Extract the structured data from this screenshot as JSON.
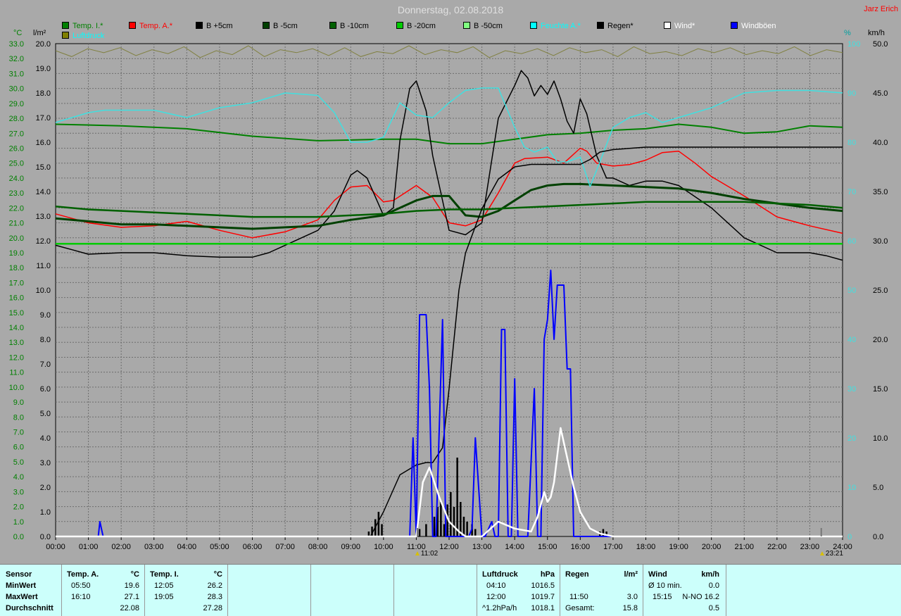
{
  "header": {
    "title": "Donnerstag, 02.08.2018",
    "author": "Jarz Erich"
  },
  "axis_units": {
    "temp": "°C",
    "rain": "l/m²",
    "right1": "%",
    "right2": "km/h"
  },
  "legend": [
    {
      "label": "Temp. I.*",
      "color": "#008000"
    },
    {
      "label": "Temp. A.*",
      "color": "#ff0000"
    },
    {
      "label": "B +5cm",
      "color": "#000000"
    },
    {
      "label": "B -5cm",
      "color": "#004000"
    },
    {
      "label": "B -10cm",
      "color": "#006000"
    },
    {
      "label": "B -20cm",
      "color": "#00cc00"
    },
    {
      "label": "B -50cm",
      "color": "#80ff80"
    },
    {
      "label": "Feuchte A.*",
      "color": "#00ffff"
    },
    {
      "label": "Regen*",
      "color": "#000000"
    },
    {
      "label": "Wind*",
      "color": "#ffffff"
    },
    {
      "label": "Windböen",
      "color": "#0000ff"
    },
    {
      "label": "Luftdruck",
      "color": "#808000"
    }
  ],
  "chart_data": {
    "type": "line",
    "title": "Donnerstag, 02.08.2018",
    "x_ticks": [
      "00:00",
      "01:00",
      "02:00",
      "03:00",
      "04:00",
      "05:00",
      "06:00",
      "07:00",
      "08:00",
      "09:00",
      "10:00",
      "11:00",
      "12:00",
      "13:00",
      "14:00",
      "15:00",
      "16:00",
      "17:00",
      "18:00",
      "19:00",
      "20:00",
      "21:00",
      "22:00",
      "23:00",
      "24:00"
    ],
    "temp_ticks": [
      "0.0",
      "1.0",
      "2.0",
      "3.0",
      "4.0",
      "5.0",
      "6.0",
      "7.0",
      "8.0",
      "9.0",
      "10.0",
      "11.0",
      "12.0",
      "13.0",
      "14.0",
      "15.0",
      "16.0",
      "17.0",
      "18.0",
      "19.0",
      "20.0",
      "21.0",
      "22.0",
      "23.0",
      "24.0",
      "25.0",
      "26.0",
      "27.0",
      "28.0",
      "29.0",
      "30.0",
      "31.0",
      "32.0",
      "33.0"
    ],
    "rain_ticks": [
      "0.0",
      "1.0",
      "2.0",
      "3.0",
      "4.0",
      "5.0",
      "6.0",
      "7.0",
      "8.0",
      "9.0",
      "10.0",
      "11.0",
      "12.0",
      "13.0",
      "14.0",
      "15.0",
      "16.0",
      "17.0",
      "18.0",
      "19.0",
      "20.0"
    ],
    "hum_ticks": [
      "0",
      "10",
      "20",
      "30",
      "40",
      "50",
      "60",
      "70",
      "80",
      "90",
      "100"
    ],
    "wind_ticks": [
      "0.0",
      "5.0",
      "10.0",
      "15.0",
      "20.0",
      "25.0",
      "30.0",
      "35.0",
      "40.0",
      "45.0",
      "50.0"
    ],
    "temp_range": [
      0,
      33
    ],
    "hum_range": [
      0,
      100
    ],
    "wind_range": [
      0,
      50
    ],
    "grid": true,
    "series": [
      {
        "name": "Temp. A.*",
        "color": "#ff0000",
        "width": 1.5,
        "axis": "temp",
        "x": [
          0,
          0.5,
          1,
          2,
          3,
          4,
          5,
          6,
          7,
          8,
          8.5,
          9,
          9.5,
          10,
          10.3,
          11,
          11.5,
          12,
          12.5,
          13,
          13.5,
          14,
          14.3,
          15,
          15.5,
          16,
          16.2,
          16.5,
          17,
          17.5,
          18,
          18.5,
          19,
          19.5,
          20,
          21,
          22,
          23,
          24
        ],
        "y": [
          21.6,
          21.3,
          21.0,
          20.7,
          20.8,
          21.1,
          20.5,
          20.0,
          20.4,
          21.2,
          22.5,
          23.4,
          23.5,
          22.4,
          22.5,
          23.5,
          22.7,
          21.0,
          20.8,
          21.2,
          23.0,
          25.0,
          25.3,
          25.4,
          25.0,
          26.0,
          25.8,
          25.0,
          24.8,
          24.9,
          25.2,
          25.7,
          25.8,
          25.0,
          24.1,
          22.8,
          21.4,
          20.8,
          20.3
        ]
      },
      {
        "name": "Temp. I.*",
        "color": "#008000",
        "width": 2,
        "axis": "temp",
        "x": [
          0,
          2,
          4,
          6,
          8,
          10,
          11,
          12,
          13,
          14,
          15,
          16,
          17,
          18,
          19,
          20,
          21,
          22,
          23,
          24
        ],
        "y": [
          27.6,
          27.5,
          27.3,
          26.8,
          26.5,
          26.6,
          26.6,
          26.3,
          26.3,
          26.6,
          26.9,
          27.0,
          27.2,
          27.3,
          27.6,
          27.4,
          27.0,
          27.1,
          27.5,
          27.4
        ]
      },
      {
        "name": "B +5cm",
        "color": "#000000",
        "width": 1.5,
        "axis": "temp",
        "x": [
          0,
          0.5,
          1,
          2,
          3,
          4,
          5,
          6,
          6.5,
          7,
          7.5,
          8,
          8.5,
          9,
          9.2,
          9.5,
          10,
          10.3,
          10.5,
          10.8,
          11,
          11.3,
          11.5,
          12,
          12.5,
          13,
          13.5,
          14,
          14.2,
          14.4,
          14.6,
          14.8,
          15,
          15.2,
          15.4,
          15.6,
          15.8,
          16,
          16.2,
          16.5,
          16.8,
          17,
          17.5,
          18,
          18.5,
          19,
          20,
          21,
          22,
          23,
          23.5,
          24
        ],
        "y": [
          19.5,
          19.2,
          18.9,
          19.0,
          19.0,
          18.8,
          18.7,
          18.7,
          19.0,
          19.5,
          20.0,
          20.5,
          21.8,
          24.2,
          24.5,
          24.0,
          21.5,
          22.0,
          26.5,
          30.0,
          30.5,
          28.5,
          25.5,
          20.5,
          20.2,
          21.0,
          28.0,
          30.2,
          31.2,
          30.7,
          29.5,
          30.2,
          29.6,
          30.5,
          29.3,
          27.8,
          27.0,
          29.3,
          28.3,
          25.5,
          24.0,
          24.0,
          23.5,
          23.8,
          23.8,
          23.5,
          22.0,
          20.0,
          19.0,
          19.0,
          18.8,
          18.5
        ]
      },
      {
        "name": "B -5cm",
        "color": "#004000",
        "width": 3,
        "axis": "temp",
        "x": [
          0,
          1,
          2,
          3,
          4,
          5,
          6,
          7,
          8,
          9,
          10,
          10.5,
          11,
          11.5,
          12,
          12.5,
          13,
          13.5,
          14,
          14.5,
          15,
          15.5,
          16,
          17,
          18,
          19,
          20,
          21,
          22,
          23,
          24
        ],
        "y": [
          21.3,
          21.1,
          20.9,
          20.9,
          20.8,
          20.7,
          20.6,
          20.7,
          20.8,
          21.2,
          21.5,
          22.0,
          22.5,
          22.8,
          22.8,
          21.5,
          21.4,
          21.8,
          22.5,
          23.2,
          23.5,
          23.6,
          23.6,
          23.5,
          23.4,
          23.3,
          23.0,
          22.6,
          22.3,
          22.0,
          21.8
        ]
      },
      {
        "name": "B -10cm",
        "color": "#006000",
        "width": 2.5,
        "axis": "temp",
        "x": [
          0,
          1,
          2,
          3,
          4,
          5,
          6,
          7,
          8,
          9,
          10,
          11,
          12,
          13,
          14,
          15,
          16,
          17,
          18,
          19,
          20,
          21,
          22,
          23,
          24
        ],
        "y": [
          22.1,
          21.9,
          21.8,
          21.7,
          21.6,
          21.5,
          21.4,
          21.4,
          21.4,
          21.5,
          21.6,
          21.8,
          21.9,
          21.9,
          22.0,
          22.1,
          22.2,
          22.3,
          22.4,
          22.4,
          22.4,
          22.4,
          22.3,
          22.2,
          22.0
        ]
      },
      {
        "name": "B -20cm",
        "color": "#00cc00",
        "width": 2.5,
        "axis": "temp",
        "x": [
          0,
          24
        ],
        "y": [
          19.6,
          19.6
        ]
      },
      {
        "name": "Feuchte A.*",
        "color": "#40e0e0",
        "width": 1.5,
        "axis": "hum",
        "x": [
          0,
          0.5,
          1,
          1.5,
          2,
          3,
          4,
          5,
          6,
          7,
          8,
          8.5,
          9,
          9.5,
          10,
          10.5,
          11,
          11.5,
          12,
          12.5,
          13,
          13.5,
          14,
          14.3,
          14.6,
          15,
          15.3,
          15.6,
          16,
          16.3,
          16.6,
          17,
          17.5,
          18,
          18.5,
          19,
          20,
          21,
          22,
          23,
          24
        ],
        "y": [
          84,
          85,
          86,
          86.5,
          86.5,
          86.5,
          85,
          87,
          88,
          90,
          89.5,
          86,
          80,
          80,
          81,
          88,
          85.5,
          85,
          88,
          90.5,
          91,
          91,
          83,
          79,
          78,
          79,
          76,
          76,
          77,
          71,
          76,
          83,
          85,
          86,
          84,
          85,
          87,
          90,
          90.5,
          90.5,
          90
        ]
      },
      {
        "name": "Regen*",
        "color": "#000000",
        "width": 1.5,
        "axis": "rain",
        "x": [
          0,
          9.6,
          10,
          10.5,
          11,
          11.3,
          11.5,
          11.8,
          12,
          12.3,
          12.5,
          13,
          13.5,
          14,
          14.5,
          15,
          15.5,
          16,
          16.3,
          16.6,
          17,
          18,
          24
        ],
        "y": [
          0,
          0,
          1.0,
          2.5,
          2.9,
          3.0,
          3.0,
          3.6,
          6.0,
          10.0,
          11.5,
          13.3,
          14.5,
          15.0,
          15.1,
          15.1,
          15.1,
          15.1,
          15.3,
          15.6,
          15.7,
          15.8,
          15.8
        ]
      },
      {
        "name": "Windböen",
        "color": "#0000ff",
        "width": 2,
        "axis": "wind",
        "x": [
          0,
          1.3,
          1.35,
          1.45,
          2,
          10.8,
          10.9,
          11.0,
          11.1,
          11.3,
          11.4,
          11.5,
          11.6,
          11.8,
          11.9,
          12.0,
          12.1,
          12.6,
          12.7,
          12.8,
          13.0,
          13.1,
          13.3,
          13.4,
          13.5,
          13.6,
          13.7,
          13.8,
          13.9,
          14.0,
          14.1,
          14.3,
          14.4,
          14.6,
          14.7,
          14.8,
          14.9,
          15.0,
          15.1,
          15.2,
          15.3,
          15.4,
          15.5,
          15.6,
          15.7,
          15.8,
          15.9,
          16.0,
          16.1,
          16.2,
          24
        ],
        "y": [
          0,
          0,
          1.5,
          0,
          0,
          0,
          10,
          0,
          22.5,
          22.5,
          15,
          0,
          0,
          22,
          0,
          0,
          0,
          0,
          0.8,
          10,
          0,
          0,
          1.5,
          0,
          0,
          21,
          21,
          0,
          0,
          16,
          0,
          0,
          0,
          15,
          0,
          0,
          20,
          22,
          27,
          20,
          25.5,
          25.5,
          25.5,
          17,
          17,
          0,
          0,
          0,
          0,
          0,
          0
        ]
      },
      {
        "name": "Wind*",
        "color": "#ffffff",
        "width": 2.5,
        "axis": "wind",
        "x": [
          0,
          11,
          11.2,
          11.4,
          11.7,
          12,
          12.3,
          12.5,
          13,
          13.5,
          14,
          14.5,
          14.7,
          14.9,
          15.0,
          15.1,
          15.2,
          15.4,
          15.6,
          15.8,
          16,
          16.3,
          16.6,
          17,
          24
        ],
        "y": [
          0,
          0,
          5.5,
          7.0,
          4,
          1.5,
          0.5,
          0,
          0,
          1.5,
          0.8,
          0.5,
          2,
          4.5,
          3.5,
          4.0,
          5.5,
          11,
          8,
          5,
          2.5,
          0.8,
          0.3,
          0,
          0
        ]
      }
    ],
    "rain_bars": {
      "color": "#000000",
      "axis": "rain",
      "x": [
        9.55,
        9.65,
        9.75,
        9.85,
        9.95,
        11.1,
        11.3,
        11.55,
        11.65,
        11.75,
        11.85,
        11.95,
        12.05,
        12.15,
        12.25,
        12.35,
        12.45,
        12.55,
        12.7,
        12.8,
        16.6,
        16.7,
        16.8
      ],
      "values": [
        0.2,
        0.4,
        0.7,
        1.0,
        0.5,
        0.3,
        0.5,
        0.8,
        1.2,
        1.4,
        0.5,
        1.3,
        1.8,
        1.2,
        3.2,
        1.4,
        0.8,
        0.6,
        0.5,
        0.3,
        0.2,
        0.3,
        0.2
      ]
    },
    "pressure_band": {
      "name": "Luftdruck",
      "color": "#808040",
      "values": [
        1018.1,
        1017.5,
        1018.3,
        1017.9,
        1018.4,
        1017.6,
        1018.2,
        1017.8,
        1018.5,
        1017.4,
        1018.1,
        1017.7,
        1018.6,
        1017.5,
        1018.2,
        1017.9,
        1018.3,
        1017.6,
        1018.4,
        1017.5,
        1018.0,
        1017.8,
        1018.6,
        1017.7,
        1018.2,
        1017.9,
        1018.5,
        1017.4,
        1018.1,
        1017.8,
        1018.3,
        1017.6,
        1018.4,
        1017.9,
        1018.2,
        1017.5,
        1018.5,
        1017.8,
        1018.0,
        1017.6,
        1018.3,
        1017.9,
        1018.4,
        1017.7,
        1018.1,
        1017.8,
        1018.5,
        1017.6,
        1018.2,
        1017.9
      ]
    },
    "markers": [
      {
        "time": "11:02"
      },
      {
        "time": "23:21"
      }
    ]
  },
  "stats": {
    "row_labels": [
      "Sensor",
      "MinWert",
      "MaxWert",
      "Durchschnitt"
    ],
    "temp_a": {
      "header": "Temp. A.",
      "unit": "°C",
      "min_time": "05:50",
      "min": "19.6",
      "max_time": "16:10",
      "max": "27.1",
      "avg": "22.08"
    },
    "temp_i": {
      "header": "Temp. I.",
      "unit": "°C",
      "min_time": "12:05",
      "min": "26.2",
      "max_time": "19:05",
      "max": "28.3",
      "avg": "27.28"
    },
    "pressure": {
      "header": "Luftdruck",
      "unit": "hPa",
      "min_time": "04:10",
      "min": "1016.5",
      "max_time": "12:00",
      "max": "1019.7",
      "trend_label": "^1.2hPa/h",
      "trend": "1018.1"
    },
    "rain": {
      "header": "Regen",
      "unit": "l/m²",
      "max_time": "11:50",
      "max": "3.0",
      "total_label": "Gesamt:",
      "total": "15.8"
    },
    "wind": {
      "header": "Wind",
      "unit": "km/h",
      "avg_label": "Ø 10 min.",
      "avg": "0.0",
      "max_time": "15:15",
      "max_dir": "N-NO 16.2",
      "avg_val": "0.5"
    }
  }
}
